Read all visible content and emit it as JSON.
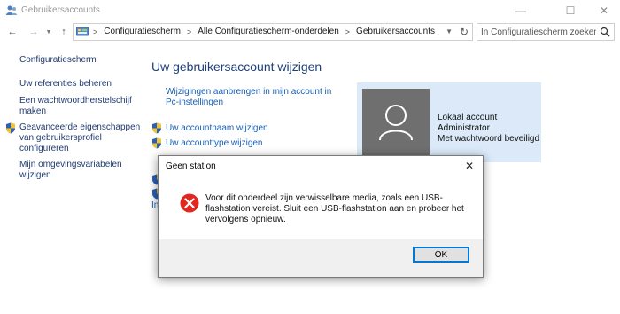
{
  "window": {
    "title": "Gebruikersaccounts",
    "min": "—",
    "max": "☐",
    "close": "✕"
  },
  "nav": {
    "back": "←",
    "forward": "→",
    "dropdown": "▼",
    "up": "↑",
    "breadcrumbs": [
      "Configuratiescherm",
      "Alle Configuratiescherm-onderdelen",
      "Gebruikersaccounts"
    ],
    "sep": ">",
    "refresh": "↻",
    "search_placeholder": "In Configuratiescherm zoeken"
  },
  "sidebar": {
    "items": [
      {
        "label": "Configuratiescherm"
      },
      {
        "label": "Uw referenties beheren"
      },
      {
        "label_lines": [
          "Een wachtwoordherstelschijf",
          "maken"
        ]
      },
      {
        "label_lines": [
          "Geavanceerde eigenschappen",
          "van gebruikersprofiel",
          "configureren"
        ],
        "icon": "shield-icon"
      },
      {
        "label_lines": [
          "Mijn omgevingsvariabelen",
          "wijzigen"
        ]
      }
    ]
  },
  "main": {
    "heading": "Uw gebruikersaccount wijzigen",
    "link_pc_lines": [
      "Wijzigingen aanbrengen in mijn account in",
      "Pc-instellingen"
    ],
    "link_name": "Uw accountnaam wijzigen",
    "link_type": "Uw accounttype wijzigen",
    "partial_link": "Ins"
  },
  "account": {
    "lines": [
      "Lokaal account",
      "Administrator",
      "Met wachtwoord beveiligd"
    ]
  },
  "dialog": {
    "title": "Geen station",
    "close": "✕",
    "message": "Voor dit onderdeel zijn verwisselbare media, zoals een USB-flashstation vereist. Sluit een USB-flashstation aan en probeer het vervolgens opnieuw.",
    "ok_label": "OK"
  },
  "colors": {
    "link": "#1a5fb4",
    "heading": "#1e3f7a",
    "account_panel": "#dbe9f8",
    "error_red": "#e0281e",
    "ok_border": "#0078d7"
  }
}
